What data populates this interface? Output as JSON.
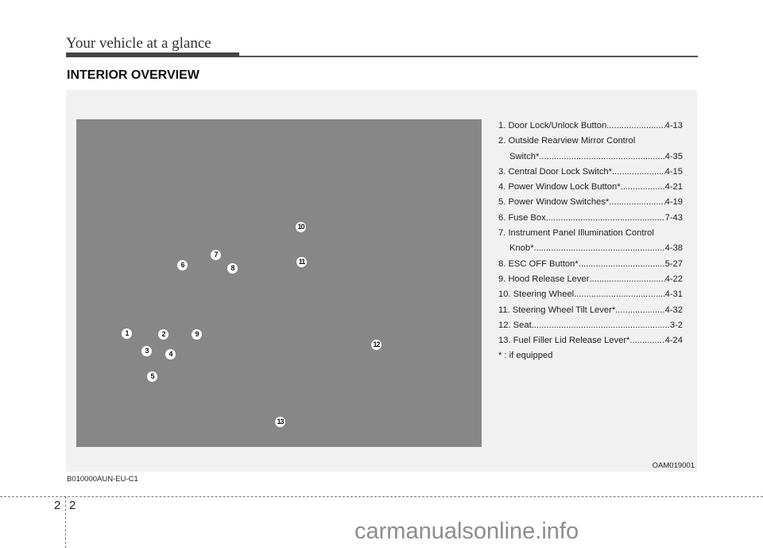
{
  "header": {
    "title": "Your vehicle at a glance"
  },
  "section": {
    "title": "INTERIOR OVERVIEW"
  },
  "figure": {
    "code": "OAM019001",
    "callouts": [
      "1",
      "2",
      "3",
      "4",
      "5",
      "6",
      "7",
      "8",
      "9",
      "10",
      "11",
      "12",
      "13"
    ]
  },
  "legend": {
    "items": [
      {
        "label": "1. Door Lock/Unlock Button",
        "page": "4-13"
      },
      {
        "label": "2. Outside Rearview Mirror Control",
        "cont": "Switch*",
        "page": "4-35"
      },
      {
        "label": "3. Central Door Lock Switch*",
        "page": "4-15"
      },
      {
        "label": "4. Power Window Lock Button*",
        "page": "4-21"
      },
      {
        "label": "5. Power Window Switches*",
        "page": "4-19"
      },
      {
        "label": "6. Fuse Box",
        "page": "7-43"
      },
      {
        "label": "7. Instrument Panel Illumination Control",
        "cont": "Knob*",
        "page": "4-38"
      },
      {
        "label": "8. ESC OFF Button*",
        "page": "5-27"
      },
      {
        "label": "9. Hood Release Lever",
        "page": "4-22"
      },
      {
        "label": "10. Steering Wheel",
        "page": "4-31"
      },
      {
        "label": "11. Steering Wheel Tilt Lever*",
        "page": "4-32"
      },
      {
        "label": "12. Seat",
        "page": "3-2"
      },
      {
        "label": "13. Fuel Filler Lid Release Lever*",
        "page": "4-24"
      }
    ],
    "footnote": "* : if equipped"
  },
  "doc_code": "B010000AUN-EU-C1",
  "footer": {
    "chapter": "2",
    "page": "2"
  },
  "watermark": "carmanualsonline.info"
}
